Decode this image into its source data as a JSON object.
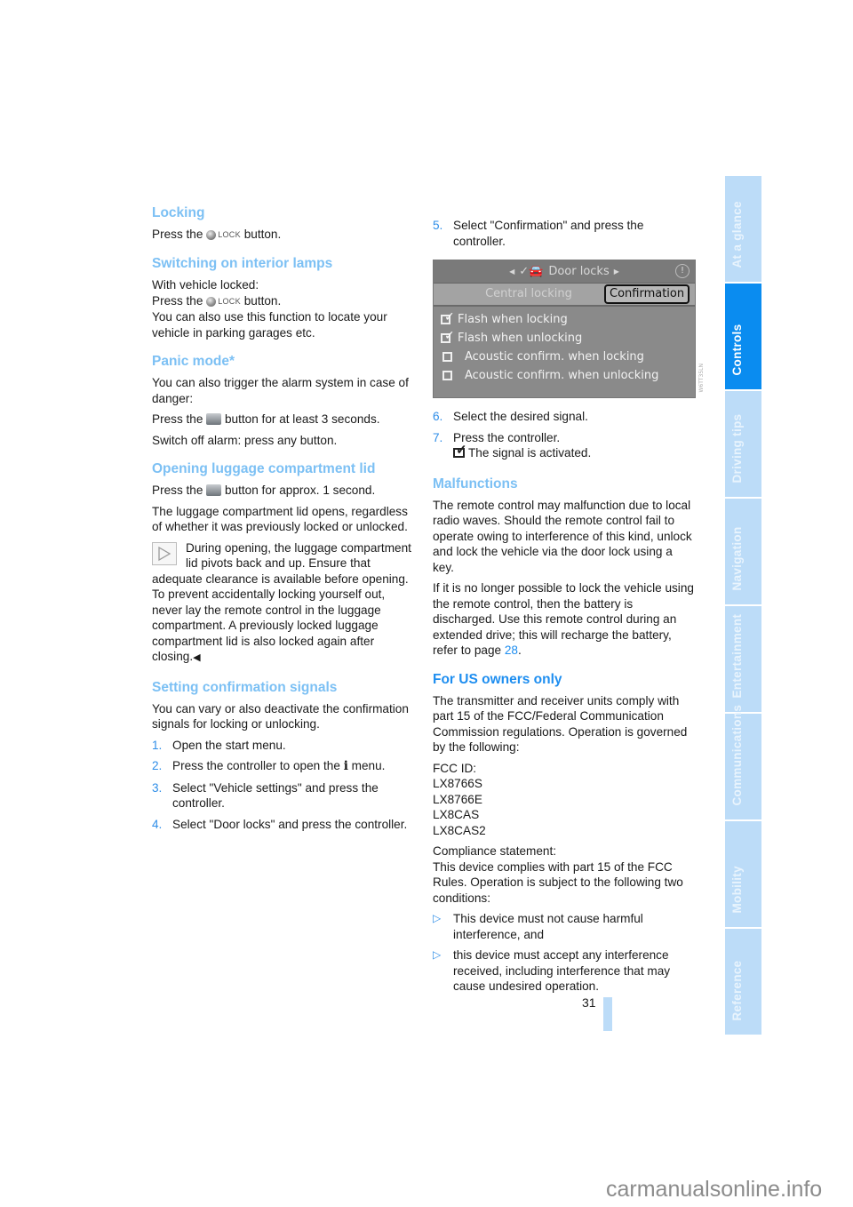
{
  "left": {
    "locking": {
      "heading": "Locking",
      "pre": "Press the",
      "icon_label": "LOCK",
      "post": "button."
    },
    "interior": {
      "heading": "Switching on interior lamps",
      "line1": "With vehicle locked:",
      "pre": "Press the",
      "icon_label": "LOCK",
      "post": "button.",
      "line3": "You can also use this function to locate your vehicle in parking garages etc."
    },
    "panic": {
      "heading": "Panic mode*",
      "p1": "You can also trigger the alarm system in case of danger:",
      "pre": "Press the",
      "post": "button for at least 3 seconds.",
      "p3": "Switch off alarm: press any button."
    },
    "luggage": {
      "heading": "Opening luggage compartment lid",
      "pre": "Press the",
      "post": "button for approx. 1 second.",
      "p2": "The luggage compartment lid opens, regardless of whether it was previously locked or unlocked.",
      "note_first": "During opening, the luggage compartment lid pivots back and up. Ensure that",
      "note_rest": "adequate clearance is available before opening. To prevent accidentally locking yourself out, never lay the remote control in the luggage compartment. A previously locked luggage compartment lid is also locked again after closing.",
      "end_mark": "◀"
    },
    "confirmation": {
      "heading": "Setting confirmation signals",
      "intro": "You can vary or also deactivate the confirmation signals for locking or unlocking.",
      "steps": [
        {
          "num": "1.",
          "text": "Open the start menu."
        },
        {
          "num": "2.",
          "pre": "Press the controller to open the",
          "icon": "i",
          "post": "menu."
        },
        {
          "num": "3.",
          "text": "Select \"Vehicle settings\" and press the controller."
        },
        {
          "num": "4.",
          "text": "Select \"Door locks\" and press the controller."
        }
      ]
    }
  },
  "right": {
    "step5": {
      "num": "5.",
      "text": "Select \"Confirmation\" and press the controller."
    },
    "screen": {
      "title": "Door locks",
      "tabs": [
        "Central locking",
        "Confirmation"
      ],
      "active_tab": "Confirmation",
      "options": [
        {
          "label": "Flash when locking",
          "checked": true
        },
        {
          "label": "Flash when unlocking",
          "checked": true
        },
        {
          "label": "Acoustic confirm. when locking",
          "checked": false
        },
        {
          "label": "Acoustic confirm. when unlocking",
          "checked": false
        }
      ],
      "stamp": "W6TT35LN"
    },
    "step6": {
      "num": "6.",
      "text": "Select the desired signal."
    },
    "step7": {
      "num": "7.",
      "text": "Press the controller."
    },
    "activated": "The signal is activated.",
    "malfunctions": {
      "heading": "Malfunctions",
      "p1": "The remote control may malfunction due to local radio waves. Should the remote control fail to operate owing to interference of this kind, unlock and lock the vehicle via the door lock using a key.",
      "p2_pre": "If it is no longer possible to lock the vehicle using the remote control, then the battery is discharged. Use this remote control during an extended drive; this will recharge the battery, refer to page",
      "p2_link": "28",
      "p2_post": "."
    },
    "us": {
      "heading": "For US owners only",
      "p1": "The transmitter and receiver units comply with part 15 of the FCC/Federal Communication Commission regulations. Operation is governed by the following:",
      "fcc_label": "FCC ID:",
      "fcc_ids": [
        "LX8766S",
        "LX8766E",
        "LX8CAS",
        "LX8CAS2"
      ],
      "compliance_label": "Compliance statement:",
      "compliance_text": "This device complies with part 15 of the FCC Rules. Operation is subject to the following two conditions:",
      "bullets": [
        "This device must not cause harmful interference, and",
        "this device must accept any interference received, including interference that may cause undesired operation."
      ]
    }
  },
  "sidebar": {
    "tabs": [
      {
        "label": "At a glance",
        "active": false
      },
      {
        "label": "Controls",
        "active": true
      },
      {
        "label": "Driving tips",
        "active": false
      },
      {
        "label": "Navigation",
        "active": false
      },
      {
        "label": "Entertainment",
        "active": false
      },
      {
        "label": "Communications",
        "active": false
      },
      {
        "label": "Mobility",
        "active": false
      },
      {
        "label": "Reference",
        "active": false
      }
    ]
  },
  "page_number": "31",
  "watermark": "carmanualsonline.info",
  "colors": {
    "heading": "#7cc0f4",
    "heading_strong": "#1e8ef0",
    "accent": "#2f8ee8",
    "tab_active": "#0a8cf0",
    "tab_idle": "#bcdcf8"
  }
}
